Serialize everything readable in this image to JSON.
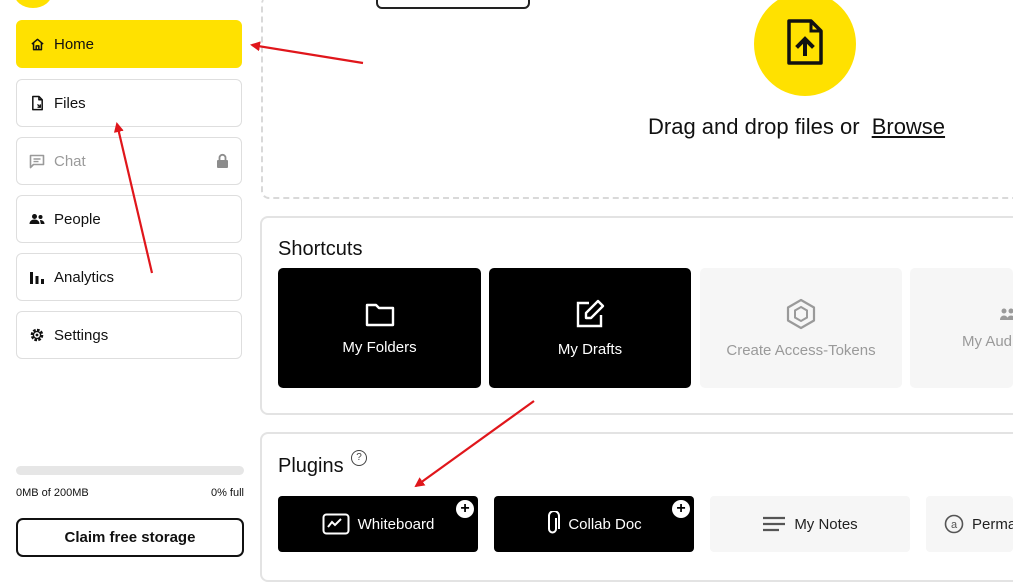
{
  "sidebar": {
    "items": [
      {
        "label": "Home",
        "icon": "home-icon",
        "state": "active"
      },
      {
        "label": "Files",
        "icon": "file-icon",
        "state": "normal"
      },
      {
        "label": "Chat",
        "icon": "chat-icon",
        "state": "locked"
      },
      {
        "label": "People",
        "icon": "people-icon",
        "state": "normal"
      },
      {
        "label": "Analytics",
        "icon": "bar-chart-icon",
        "state": "normal"
      },
      {
        "label": "Settings",
        "icon": "gear-icon",
        "state": "normal"
      }
    ],
    "storage": {
      "used_text": "0MB of 200MB",
      "percent_text": "0% full",
      "fill_fraction": 0
    },
    "claim_label": "Claim free storage"
  },
  "upload": {
    "text": "Drag and drop files or",
    "browse_label": "Browse",
    "icon": "file-upload-icon"
  },
  "shortcuts": {
    "title": "Shortcuts",
    "items": [
      {
        "label": "My Folders",
        "icon": "folder-icon",
        "style": "dark"
      },
      {
        "label": "My Drafts",
        "icon": "edit-icon",
        "style": "dark"
      },
      {
        "label": "Create Access-Tokens",
        "icon": "hexagon-icon",
        "style": "disabled"
      },
      {
        "label": "My Aud",
        "icon": "audience-icon",
        "style": "disabled"
      }
    ]
  },
  "plugins": {
    "title": "Plugins",
    "items": [
      {
        "label": "Whiteboard",
        "icon": "whiteboard-icon",
        "style": "dark",
        "badge": "+"
      },
      {
        "label": "Collab Doc",
        "icon": "paperclip-icon",
        "style": "dark",
        "badge": "+"
      },
      {
        "label": "My Notes",
        "icon": "lines-icon",
        "style": "light"
      },
      {
        "label": "Perma",
        "icon": "at-circle-icon",
        "style": "light"
      }
    ]
  },
  "colors": {
    "accent": "#ffe100",
    "annotation_arrow": "#e0161b",
    "tile_dark": "#000000",
    "tile_light": "#f6f6f6"
  }
}
